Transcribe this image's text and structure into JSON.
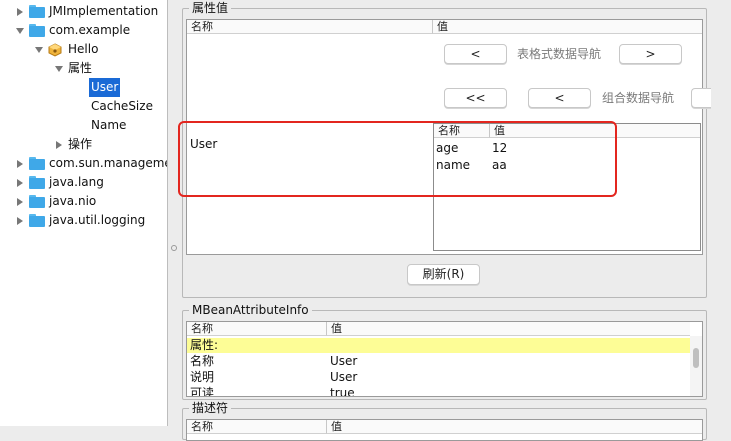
{
  "tree": {
    "items": [
      {
        "label": "JMImplementation",
        "expanded": false,
        "icon": "folder-icon"
      },
      {
        "label": "com.example",
        "expanded": true,
        "icon": "folder-icon"
      },
      {
        "label": "Hello",
        "expanded": true,
        "icon": "mbean-icon"
      },
      {
        "label": "属性",
        "expanded": true,
        "icon": ""
      },
      {
        "label": "User",
        "selected": true
      },
      {
        "label": "CacheSize"
      },
      {
        "label": "Name"
      },
      {
        "label": "操作",
        "expanded": false
      },
      {
        "label": "com.sun.manageme",
        "expanded": false,
        "icon": "folder-icon"
      },
      {
        "label": "java.lang",
        "expanded": false,
        "icon": "folder-icon"
      },
      {
        "label": "java.nio",
        "expanded": false,
        "icon": "folder-icon"
      },
      {
        "label": "java.util.logging",
        "expanded": false,
        "icon": "folder-icon"
      }
    ]
  },
  "attr_value": {
    "title": "属性值",
    "col_name": "名称",
    "col_value": "值",
    "nav1": {
      "prev": "<",
      "label": "表格式数据导航",
      "next": ">"
    },
    "nav2": {
      "first": "<<",
      "prev": "<",
      "label": "组合数据导航"
    },
    "row_name": "User",
    "inner_table": {
      "col_name": "名称",
      "col_value": "值",
      "rows": [
        {
          "name": "age",
          "value": "12"
        },
        {
          "name": "name",
          "value": "aa"
        }
      ]
    },
    "refresh_button": "刷新(R)"
  },
  "mbean_info": {
    "title": "MBeanAttributeInfo",
    "col_name": "名称",
    "col_value": "值",
    "rows": [
      {
        "name": "属性:",
        "value": "",
        "highlight": true
      },
      {
        "name": "名称",
        "value": "User"
      },
      {
        "name": "说明",
        "value": "User"
      },
      {
        "name": "可读",
        "value": "true"
      }
    ]
  },
  "descriptor": {
    "title": "描述符",
    "col_name": "名称",
    "col_value": "值"
  },
  "colors": {
    "selection": "#1a6ad6",
    "highlight_row": "#fdfd96",
    "annotation": "#e3261f",
    "folder": "#3fa8e8"
  }
}
